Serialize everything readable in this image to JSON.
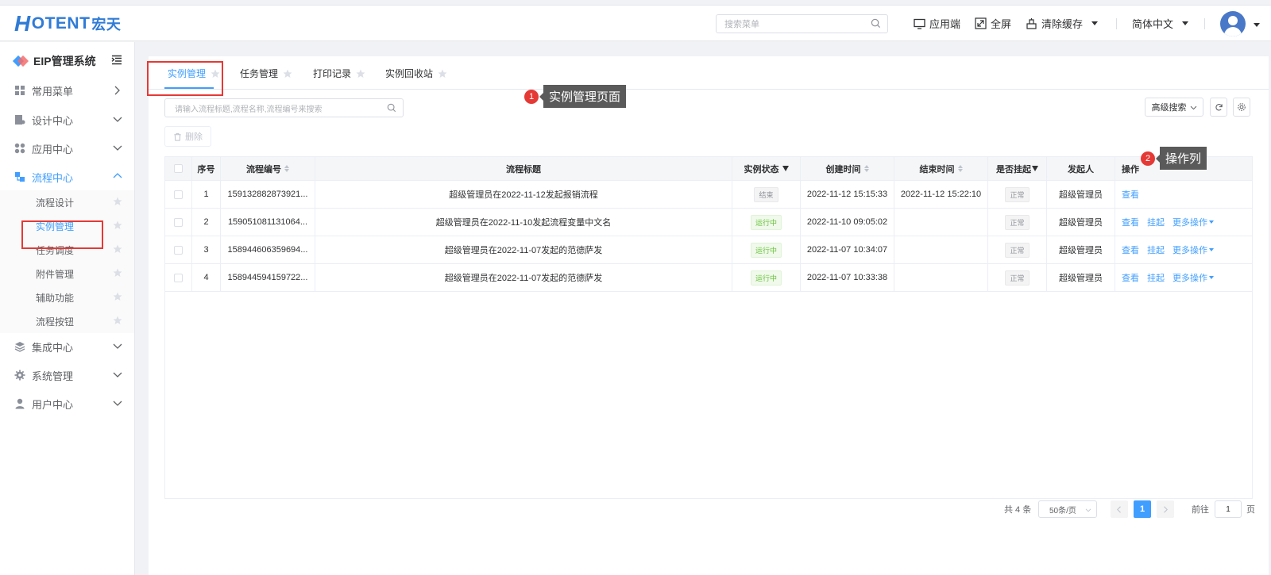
{
  "header": {
    "logo_h": "H",
    "logo_text": "OTENT",
    "logo_cn": "宏天",
    "search_placeholder": "搜索菜单",
    "app_client": "应用端",
    "fullscreen": "全屏",
    "clear_cache": "清除缓存",
    "language": "简体中文"
  },
  "sidebar": {
    "title": "EIP管理系统",
    "items": [
      {
        "label": "常用菜单"
      },
      {
        "label": "设计中心"
      },
      {
        "label": "应用中心"
      },
      {
        "label": "流程中心"
      },
      {
        "label": "集成中心"
      },
      {
        "label": "系统管理"
      },
      {
        "label": "用户中心"
      }
    ],
    "sub_items": [
      {
        "label": "流程设计"
      },
      {
        "label": "实例管理"
      },
      {
        "label": "任务调度"
      },
      {
        "label": "附件管理"
      },
      {
        "label": "辅助功能"
      },
      {
        "label": "流程按钮"
      }
    ]
  },
  "tabs": [
    {
      "label": "实例管理"
    },
    {
      "label": "任务管理"
    },
    {
      "label": "打印记录"
    },
    {
      "label": "实例回收站"
    }
  ],
  "callouts": [
    {
      "num": "1",
      "text": "实例管理页面"
    },
    {
      "num": "2",
      "text": "操作列"
    }
  ],
  "toolbar": {
    "search_placeholder": "请输入流程标题,流程名称,流程编号来搜索",
    "delete": "删除",
    "advanced_search": "高级搜索"
  },
  "table": {
    "headers": [
      "序号",
      "流程编号",
      "流程标题",
      "实例状态",
      "创建时间",
      "结束时间",
      "是否挂起",
      "发起人",
      "操作"
    ],
    "rows": [
      {
        "no": "1",
        "code": "159132882873921...",
        "title": "超级管理员在2022-11-12发起报销流程",
        "status": "结束",
        "created": "2022-11-12 15:15:33",
        "ended": "2022-11-12 15:22:10",
        "suspended": "正常",
        "initiator": "超级管理员",
        "op_view": "查看"
      },
      {
        "no": "2",
        "code": "159051081131064...",
        "title": "超级管理员在2022-11-10发起流程变量中文名",
        "status": "运行中",
        "created": "2022-11-10 09:05:02",
        "ended": "",
        "suspended": "正常",
        "initiator": "超级管理员",
        "op_view": "查看",
        "op_suspend": "挂起",
        "op_more": "更多操作"
      },
      {
        "no": "3",
        "code": "158944606359694...",
        "title": "超级管理员在2022-11-07发起的范德萨发",
        "status": "运行中",
        "created": "2022-11-07 10:34:07",
        "ended": "",
        "suspended": "正常",
        "initiator": "超级管理员",
        "op_view": "查看",
        "op_suspend": "挂起",
        "op_more": "更多操作"
      },
      {
        "no": "4",
        "code": "158944594159722...",
        "title": "超级管理员在2022-11-07发起的范德萨发",
        "status": "运行中",
        "created": "2022-11-07 10:33:38",
        "ended": "",
        "suspended": "正常",
        "initiator": "超级管理员",
        "op_view": "查看",
        "op_suspend": "挂起",
        "op_more": "更多操作"
      }
    ]
  },
  "pagination": {
    "total": "共 4 条",
    "page_size": "50条/页",
    "current": "1",
    "goto": "前往",
    "goto_value": "1",
    "page_unit": "页"
  },
  "colors": {
    "primary": "#409eff",
    "highlight": "#e53935",
    "success": "#67c23a"
  }
}
